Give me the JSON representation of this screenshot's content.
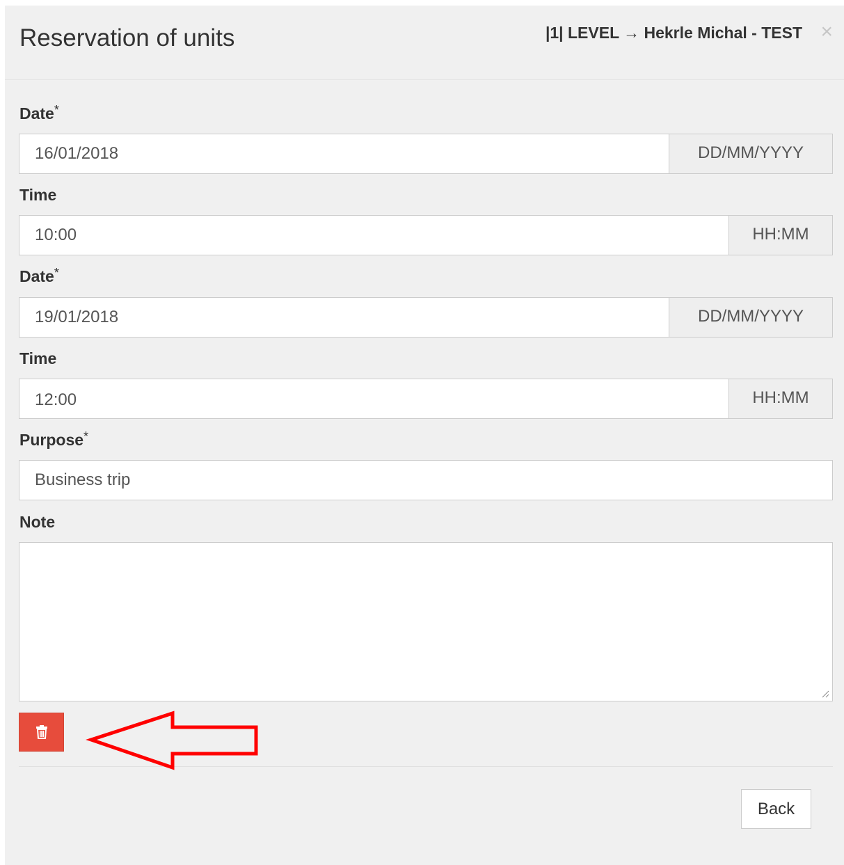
{
  "modal": {
    "title": "Reservation of units",
    "context": "|1| LEVEL → Hekrle Michal - TEST",
    "close_symbol": "×"
  },
  "form": {
    "date_from": {
      "label": "Date",
      "required_mark": "*",
      "value": "16/01/2018",
      "format_hint": "DD/MM/YYYY"
    },
    "time_from": {
      "label": "Time",
      "value": "10:00",
      "format_hint": "HH:MM"
    },
    "date_to": {
      "label": "Date",
      "required_mark": "*",
      "value": "19/01/2018",
      "format_hint": "DD/MM/YYYY"
    },
    "time_to": {
      "label": "Time",
      "value": "12:00",
      "format_hint": "HH:MM"
    },
    "purpose": {
      "label": "Purpose",
      "required_mark": "*",
      "value": "Business trip"
    },
    "note": {
      "label": "Note",
      "value": ""
    }
  },
  "actions": {
    "delete_icon": "trash-icon",
    "delete_color": "#e74c3c",
    "back_label": "Back"
  },
  "annotation": {
    "arrow_color": "#ff0000",
    "arrow_direction": "left"
  }
}
